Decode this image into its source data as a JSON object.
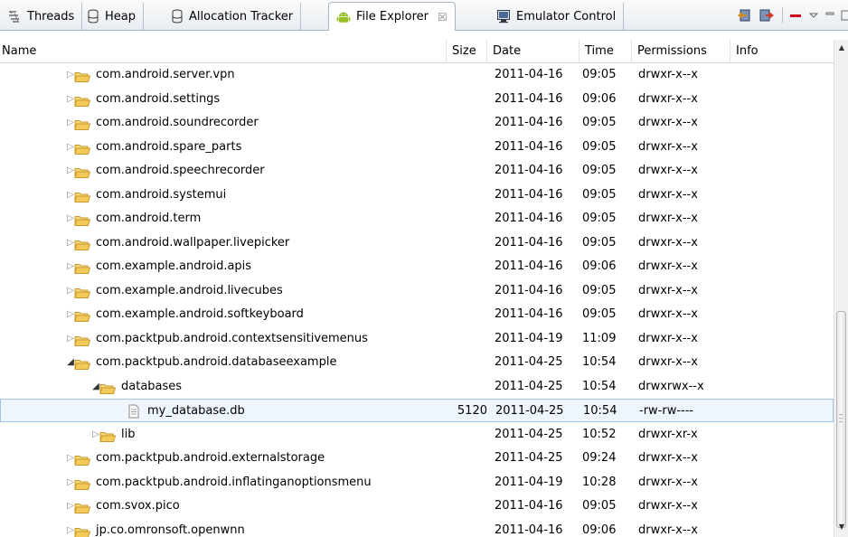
{
  "tabs": [
    {
      "label": "Threads",
      "icon": "threads-icon"
    },
    {
      "label": "Heap",
      "icon": "heap-icon"
    },
    {
      "label": "Allocation Tracker",
      "icon": "allocation-icon"
    },
    {
      "label": "File Explorer",
      "icon": "android-icon",
      "active": true,
      "close": "☒"
    },
    {
      "label": "Emulator Control",
      "icon": "emulator-icon"
    }
  ],
  "columns": {
    "name": "Name",
    "size": "Size",
    "date": "Date",
    "time": "Time",
    "permissions": "Permissions",
    "info": "Info"
  },
  "rows": [
    {
      "name": "com.android.server.vpn",
      "size": "",
      "date": "2011-04-16",
      "time": "09:05",
      "perm": "drwxr-x--x",
      "level": 1,
      "type": "folder",
      "state": "collapsed"
    },
    {
      "name": "com.android.settings",
      "size": "",
      "date": "2011-04-16",
      "time": "09:06",
      "perm": "drwxr-x--x",
      "level": 1,
      "type": "folder",
      "state": "collapsed"
    },
    {
      "name": "com.android.soundrecorder",
      "size": "",
      "date": "2011-04-16",
      "time": "09:05",
      "perm": "drwxr-x--x",
      "level": 1,
      "type": "folder",
      "state": "collapsed"
    },
    {
      "name": "com.android.spare_parts",
      "size": "",
      "date": "2011-04-16",
      "time": "09:05",
      "perm": "drwxr-x--x",
      "level": 1,
      "type": "folder",
      "state": "collapsed"
    },
    {
      "name": "com.android.speechrecorder",
      "size": "",
      "date": "2011-04-16",
      "time": "09:05",
      "perm": "drwxr-x--x",
      "level": 1,
      "type": "folder",
      "state": "collapsed"
    },
    {
      "name": "com.android.systemui",
      "size": "",
      "date": "2011-04-16",
      "time": "09:05",
      "perm": "drwxr-x--x",
      "level": 1,
      "type": "folder",
      "state": "collapsed"
    },
    {
      "name": "com.android.term",
      "size": "",
      "date": "2011-04-16",
      "time": "09:05",
      "perm": "drwxr-x--x",
      "level": 1,
      "type": "folder",
      "state": "collapsed"
    },
    {
      "name": "com.android.wallpaper.livepicker",
      "size": "",
      "date": "2011-04-16",
      "time": "09:05",
      "perm": "drwxr-x--x",
      "level": 1,
      "type": "folder",
      "state": "collapsed"
    },
    {
      "name": "com.example.android.apis",
      "size": "",
      "date": "2011-04-16",
      "time": "09:06",
      "perm": "drwxr-x--x",
      "level": 1,
      "type": "folder",
      "state": "collapsed"
    },
    {
      "name": "com.example.android.livecubes",
      "size": "",
      "date": "2011-04-16",
      "time": "09:05",
      "perm": "drwxr-x--x",
      "level": 1,
      "type": "folder",
      "state": "collapsed"
    },
    {
      "name": "com.example.android.softkeyboard",
      "size": "",
      "date": "2011-04-16",
      "time": "09:05",
      "perm": "drwxr-x--x",
      "level": 1,
      "type": "folder",
      "state": "collapsed"
    },
    {
      "name": "com.packtpub.android.contextsensitivemenus",
      "size": "",
      "date": "2011-04-19",
      "time": "11:09",
      "perm": "drwxr-x--x",
      "level": 1,
      "type": "folder",
      "state": "collapsed"
    },
    {
      "name": "com.packtpub.android.databaseexample",
      "size": "",
      "date": "2011-04-25",
      "time": "10:54",
      "perm": "drwxr-x--x",
      "level": 1,
      "type": "folder",
      "state": "expanded"
    },
    {
      "name": "databases",
      "size": "",
      "date": "2011-04-25",
      "time": "10:54",
      "perm": "drwxrwx--x",
      "level": 2,
      "type": "folder",
      "state": "expanded"
    },
    {
      "name": "my_database.db",
      "size": "5120",
      "date": "2011-04-25",
      "time": "10:54",
      "perm": "-rw-rw----",
      "level": 3,
      "type": "file",
      "state": "none",
      "selected": true
    },
    {
      "name": "lib",
      "size": "",
      "date": "2011-04-25",
      "time": "10:52",
      "perm": "drwxr-xr-x",
      "level": 2,
      "type": "folder",
      "state": "collapsed"
    },
    {
      "name": "com.packtpub.android.externalstorage",
      "size": "",
      "date": "2011-04-25",
      "time": "09:24",
      "perm": "drwxr-x--x",
      "level": 1,
      "type": "folder",
      "state": "collapsed"
    },
    {
      "name": "com.packtpub.android.inflatinganoptionsmenu",
      "size": "",
      "date": "2011-04-19",
      "time": "10:28",
      "perm": "drwxr-x--x",
      "level": 1,
      "type": "folder",
      "state": "collapsed"
    },
    {
      "name": "com.svox.pico",
      "size": "",
      "date": "2011-04-16",
      "time": "09:05",
      "perm": "drwxr-x--x",
      "level": 1,
      "type": "folder",
      "state": "collapsed"
    },
    {
      "name": "jp.co.omronsoft.openwnn",
      "size": "",
      "date": "2011-04-16",
      "time": "09:06",
      "perm": "drwxr-x--x",
      "level": 1,
      "type": "folder",
      "state": "collapsed"
    }
  ],
  "colors": {
    "accent_selection": "#9fc5ea",
    "folder": "#f0c14b",
    "android_green": "#97c024"
  }
}
